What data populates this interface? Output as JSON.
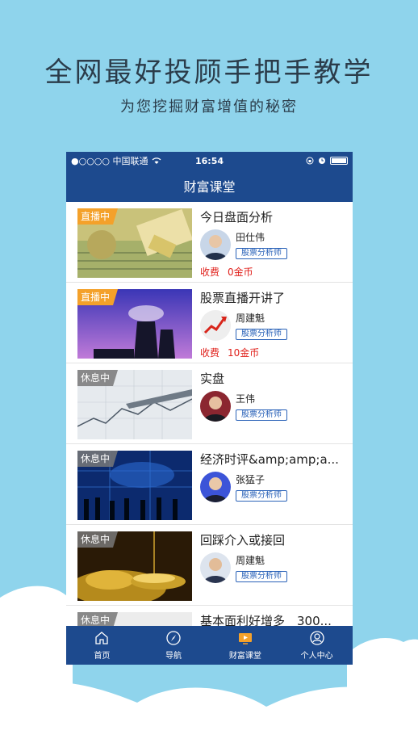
{
  "promo": {
    "headline": "全网最好投顾手把手教学",
    "subline": "为您挖掘财富增值的秘密"
  },
  "status": {
    "carrier": "●○○○○ 中国联通",
    "time": "16:54"
  },
  "navbar": {
    "title": "财富课堂"
  },
  "courses": [
    {
      "badge": "直播中",
      "title": "今日盘面分析",
      "teacher": "田仕伟",
      "role": "股票分析师",
      "price_label": "收费",
      "price": "0金币"
    },
    {
      "badge": "直播中",
      "title": "股票直播开讲了",
      "teacher": "周建魁",
      "role": "股票分析师",
      "price_label": "收费",
      "price": "10金币"
    },
    {
      "badge": "休息中",
      "title": "实盘",
      "teacher": "王伟",
      "role": "股票分析师"
    },
    {
      "badge": "休息中",
      "title": "经济时评&amp;amp;a...",
      "teacher": "张猛子",
      "role": "股票分析师"
    },
    {
      "badge": "休息中",
      "title": "回踩介入或接回",
      "teacher": "周建魁",
      "role": "股票分析师"
    },
    {
      "badge": "休息中",
      "title": "基本面利好增多　300..."
    }
  ],
  "tabs": [
    {
      "label": "首页",
      "icon": "home-icon"
    },
    {
      "label": "导航",
      "icon": "compass-icon"
    },
    {
      "label": "财富课堂",
      "icon": "video-icon"
    },
    {
      "label": "个人中心",
      "icon": "user-icon"
    }
  ],
  "colors": {
    "brand": "#1d4a8e",
    "background": "#8fd4ec",
    "live": "#f4a12a",
    "price": "#e0201b"
  }
}
